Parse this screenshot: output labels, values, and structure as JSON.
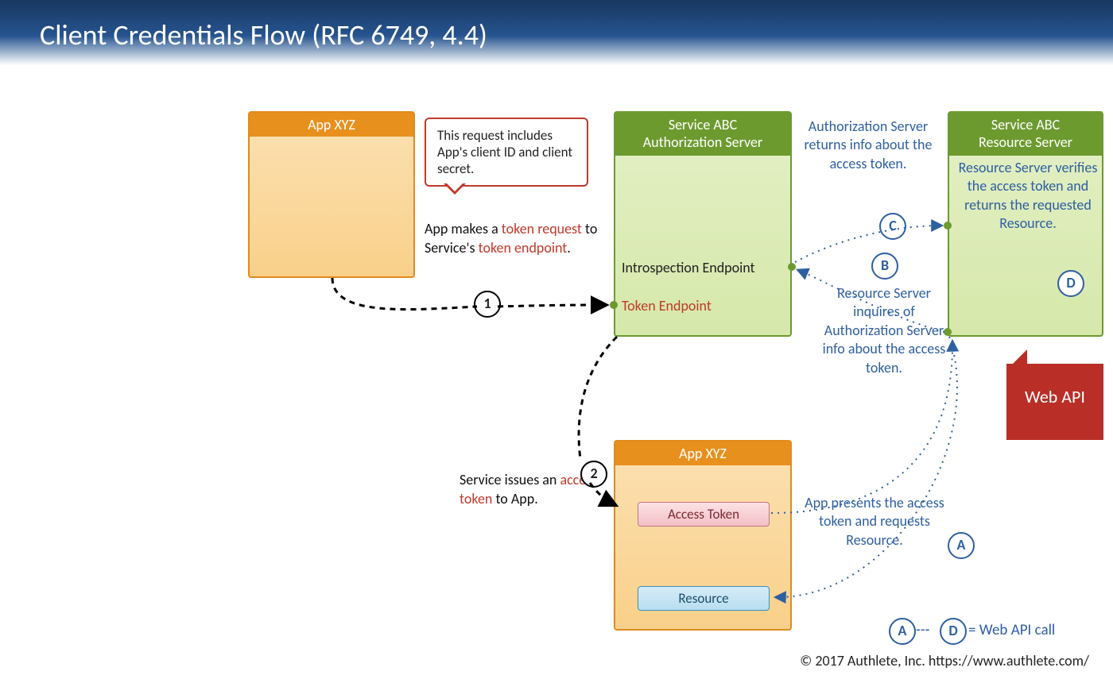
{
  "title": "Client Credentials Flow   (RFC 6749, 4.4)",
  "app_box": "App XYZ",
  "app_box2": "App XYZ",
  "auth_box": {
    "line1": "Service ABC",
    "line2": "Authorization Server"
  },
  "res_box": {
    "line1": "Service ABC",
    "line2": "Resource Server"
  },
  "introspection": "Introspection Endpoint",
  "token_ep": "Token Endpoint",
  "access_token_chip": "Access Token",
  "resource_chip": "Resource",
  "bubble": "This request includes App's client ID and client secret.",
  "step1": "1",
  "step2": "2",
  "letters": {
    "A": "A",
    "B": "B",
    "C": "C",
    "D": "D"
  },
  "note1": {
    "t": "App makes a ",
    "k1": "token request",
    "t2": " to Service's ",
    "k2": "token endpoint",
    "t3": "."
  },
  "note2": {
    "t": "Service issues an ",
    "k": "access token",
    "t2": " to App."
  },
  "bnote_c": "Authorization Server returns info about the access token.",
  "bnote_b": "Resource Server inquires of Authorization Server info about the access token.",
  "bnote_a": "App presents the access token and requests Resource.",
  "bnote_d": "Resource Server verifies the access token and returns the requested Resource.",
  "webapi": "Web API",
  "legend": " = Web API call",
  "footer": "© 2017 Authlete, Inc.  https://www.authlete.com/"
}
